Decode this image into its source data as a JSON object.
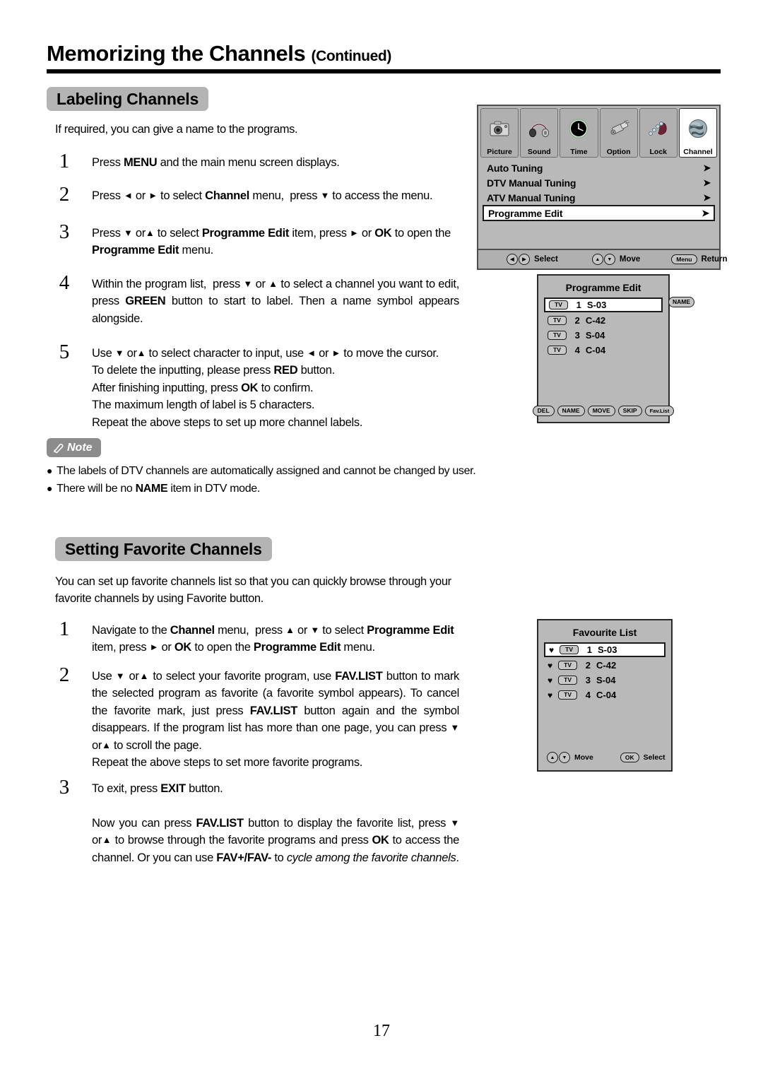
{
  "header": {
    "title": "Memorizing the Channels",
    "continued": "(Continued)"
  },
  "page_number": "17",
  "sections": {
    "labeling": {
      "heading": "Labeling Channels",
      "intro": "If required, you can give a name to the programs.",
      "steps": [
        {
          "num": "1",
          "html": "Press <b>MENU</b> and the main menu screen displays."
        },
        {
          "num": "2",
          "html": "Press <span class=\"ar\">&#9668;</span> or <span class=\"ar\">&#9658;</span> to select <b>Channel</b> menu,&nbsp; press <span class=\"ar\">&#9660;</span> to access the menu."
        },
        {
          "num": "3",
          "html": "Press <span class=\"ar\">&#9660;</span> or<span class=\"ar\">&#9650;</span> to select <b>Programme Edit</b> item, press <span class=\"ar\">&#9658;</span> or <b>OK</b> to open the <b>Programme Edit</b> menu."
        },
        {
          "num": "4",
          "html": "Within the program list,&nbsp; press <span class=\"ar\">&#9660;</span> or <span class=\"ar\">&#9650;</span> to select a channel you want to edit, press <b>GREEN</b> button to start to label. Then a name symbol appears alongside."
        },
        {
          "num": "5",
          "html": "Use <span class=\"ar\">&#9660;</span> or<span class=\"ar\">&#9650;</span> to select character to input, use <span class=\"ar\">&#9668;</span> or <span class=\"ar\">&#9658;</span> to move the cursor.<br>To delete the inputting, please press <b>RED</b> button.<br>After finishing inputting, press <b>OK</b> to confirm.<br>The maximum length of label is 5 characters.<br>Repeat the above steps to set up more channel labels."
        }
      ]
    },
    "note": {
      "label": "Note",
      "bullets": [
        "The labels of DTV channels are automatically assigned and cannot be changed by user.",
        "There will be no <b>NAME</b> item in DTV mode."
      ]
    },
    "favorite": {
      "heading": "Setting Favorite Channels",
      "intro": "You can set up favorite channels list so that you can quickly browse through your favorite channels by using Favorite button.",
      "steps": [
        {
          "num": "1",
          "html": "Navigate to the <b>Channel</b> menu,&nbsp; press <span class=\"ar\">&#9650;</span> or <span class=\"ar\">&#9660;</span> to select <b>Programme Edit</b> item, press <span class=\"ar\">&#9658;</span> or <b>OK</b> to open the <b>Programme Edit</b> menu."
        },
        {
          "num": "2",
          "html": "Use <span class=\"ar\">&#9660;</span> or<span class=\"ar\">&#9650;</span> to select your favorite program, use <b>FAV.LIST</b> button to mark the selected program as favorite (a favorite symbol appears). To cancel the favorite mark, just press <b>FAV.LIST</b> button again and the symbol disappears. If the program list has more than one page, you can press <span class=\"ar\">&#9660;</span> or<span class=\"ar\">&#9650;</span> to scroll the page.<br>Repeat the above steps to set more favorite programs."
        },
        {
          "num": "3",
          "html": "To exit, press <b>EXIT</b> button.<br><br>Now you can press <b>FAV.LIST</b> button to display the favorite list, press <span class=\"ar\">&#9660;</span> or<span class=\"ar\">&#9650;</span> to browse through the favorite programs and press <b>OK</b> to access the channel. Or you can use <b>FAV+/FAV-</b> to <i>cycle among the favorite channels</i>."
        }
      ]
    }
  },
  "osd_main_menu": {
    "tabs": [
      {
        "label": "Picture",
        "icon": "camera-icon",
        "selected": false
      },
      {
        "label": "Sound",
        "icon": "headphones-icon",
        "selected": false
      },
      {
        "label": "Time",
        "icon": "clock-icon",
        "selected": false
      },
      {
        "label": "Option",
        "icon": "connector-icon",
        "selected": false
      },
      {
        "label": "Lock",
        "icon": "padlock-chain-icon",
        "selected": false
      },
      {
        "label": "Channel",
        "icon": "globe-icon",
        "selected": true
      }
    ],
    "items": [
      {
        "label": "Auto Tuning",
        "highlight": false
      },
      {
        "label": "DTV Manual Tuning",
        "highlight": false
      },
      {
        "label": "ATV Manual Tuning",
        "highlight": false
      },
      {
        "label": "Programme Edit",
        "highlight": true
      }
    ],
    "footer": [
      {
        "key": "◀▶",
        "action": "Select"
      },
      {
        "key": "▲▼",
        "action": "Move"
      },
      {
        "key": "Menu",
        "action": "Return"
      }
    ]
  },
  "osd_programme_edit": {
    "title": "Programme Edit",
    "rows": [
      {
        "tag": "TV",
        "no": "1",
        "name": "S-03",
        "highlight": true
      },
      {
        "tag": "TV",
        "no": "2",
        "name": "C-42",
        "highlight": false
      },
      {
        "tag": "TV",
        "no": "3",
        "name": "S-04",
        "highlight": false
      },
      {
        "tag": "TV",
        "no": "4",
        "name": "C-04",
        "highlight": false
      }
    ],
    "buttons": [
      "DEL",
      "NAME",
      "MOVE",
      "SKIP",
      "Fav.List"
    ],
    "name_badge": "NAME"
  },
  "osd_favourite_list": {
    "title": "Favourite List",
    "heart": "♥",
    "rows": [
      {
        "tag": "TV",
        "no": "1",
        "name": "S-03",
        "highlight": true
      },
      {
        "tag": "TV",
        "no": "2",
        "name": "C-42",
        "highlight": false
      },
      {
        "tag": "TV",
        "no": "3",
        "name": "S-04",
        "highlight": false
      },
      {
        "tag": "TV",
        "no": "4",
        "name": "C-04",
        "highlight": false
      }
    ],
    "footer": [
      {
        "key": "▲▼",
        "action": "Move"
      },
      {
        "key": "OK",
        "action": "Select"
      }
    ]
  },
  "colors": {
    "pill_grey": "#b4b4b4",
    "note_grey": "#8c8c8c",
    "osd_grey": "#b9b9b9",
    "osd_tab_grey": "#b0b0b0",
    "rule_black": "#000000"
  }
}
